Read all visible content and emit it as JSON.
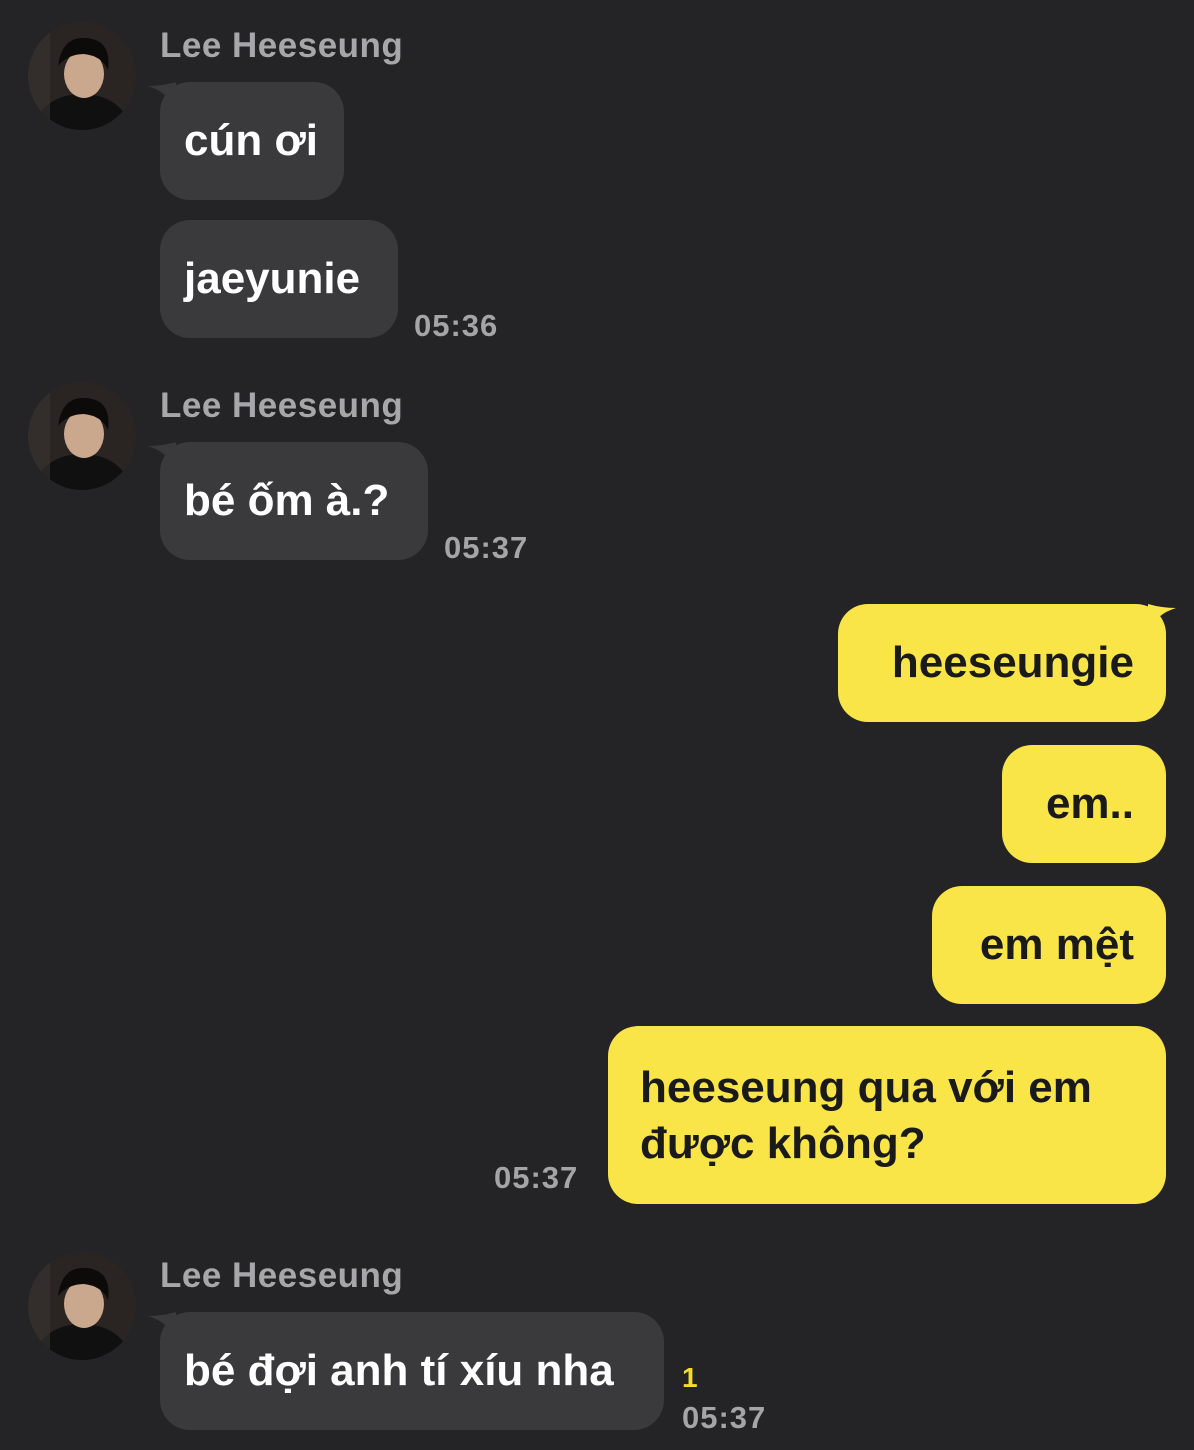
{
  "colors": {
    "background": "#242427",
    "incoming_bubble": "#3a3a3d",
    "outgoing_bubble": "#f9e547",
    "unread_count": "#f5dc2a"
  },
  "groups": [
    {
      "sender": "Lee Heeseung",
      "avatar_icon": "profile-photo-avatar",
      "messages": [
        "cún ơi",
        "jaeyunie"
      ],
      "time": "05:36"
    },
    {
      "sender": "Lee Heeseung",
      "avatar_icon": "profile-photo-avatar",
      "messages": [
        "bé ốm à.?"
      ],
      "time": "05:37"
    },
    {
      "sender": "me",
      "messages": [
        "heeseungie",
        "em..",
        "em mệt",
        "heeseung qua với em được không?"
      ],
      "time": "05:37"
    },
    {
      "sender": "Lee Heeseung",
      "avatar_icon": "profile-photo-avatar",
      "messages": [
        "bé đợi anh tí xíu nha"
      ],
      "unread": "1",
      "time": "05:37"
    }
  ]
}
